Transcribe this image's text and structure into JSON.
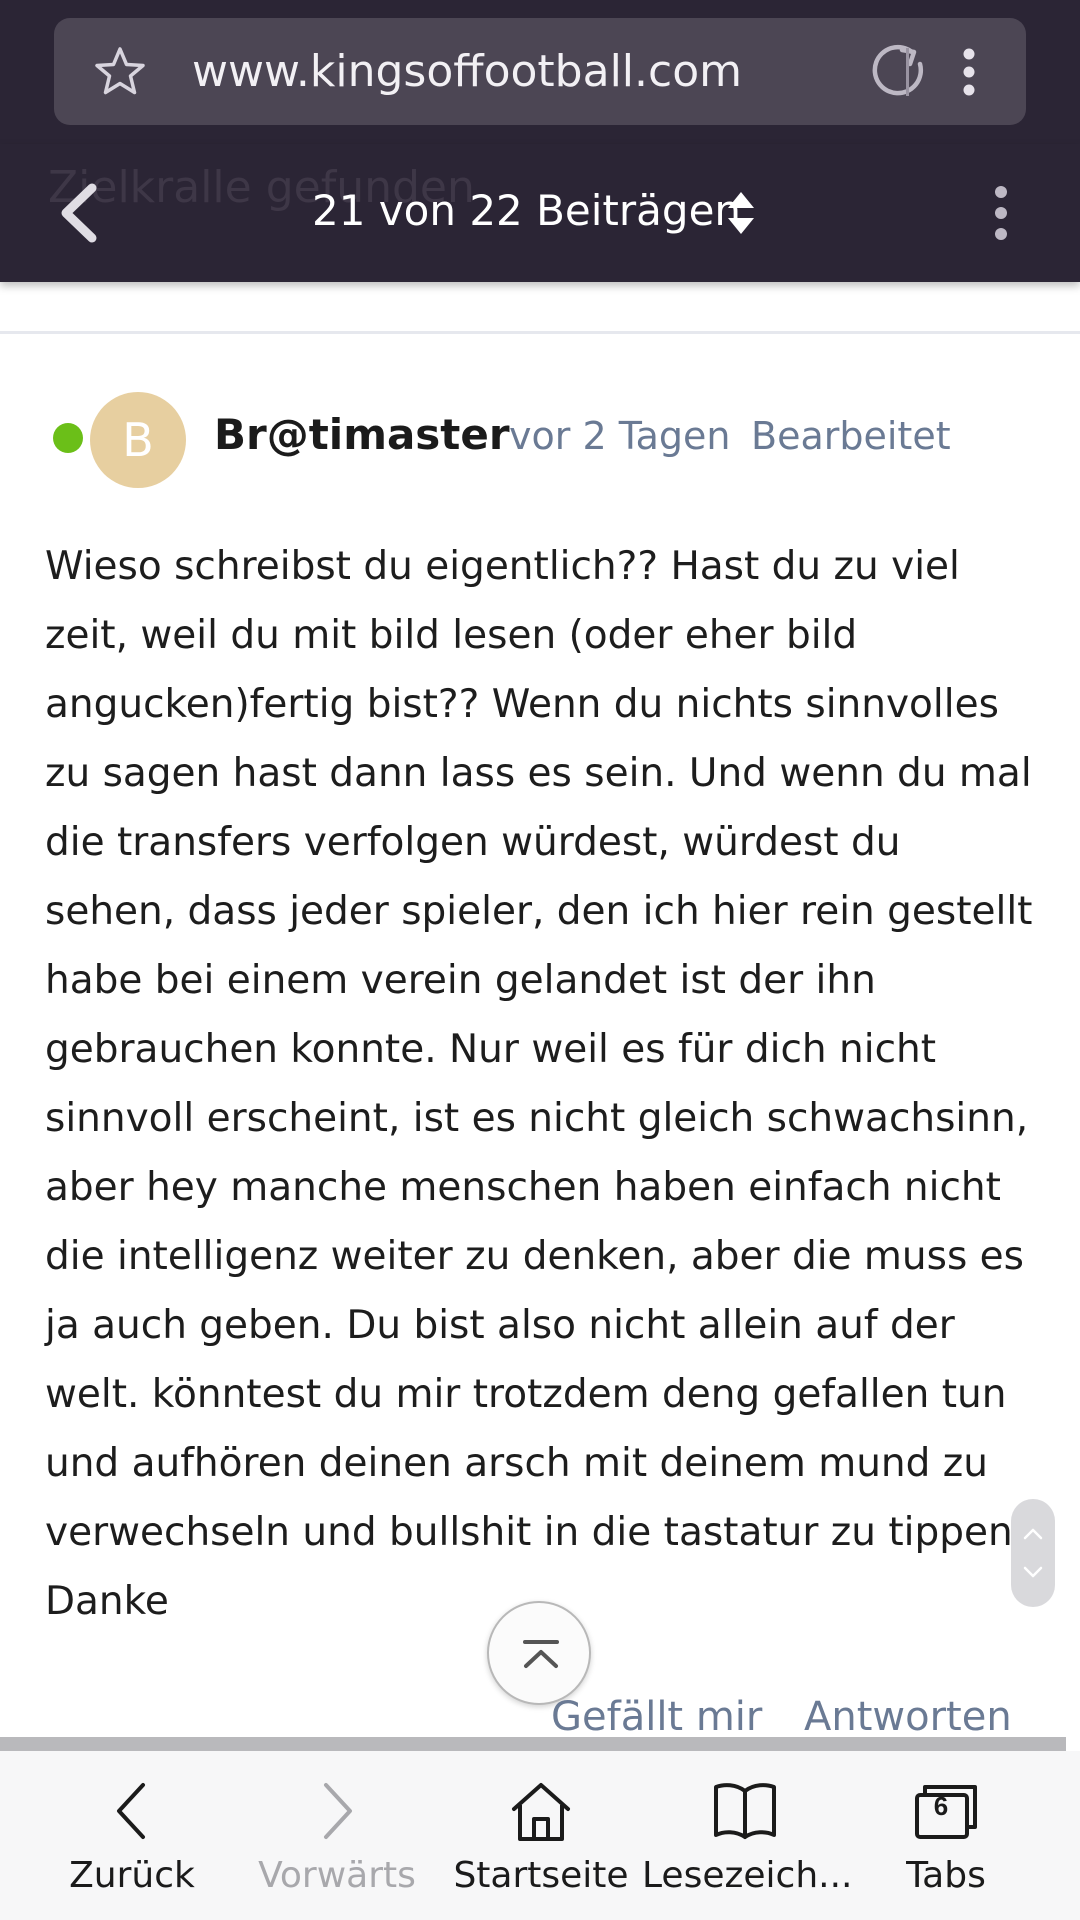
{
  "browser": {
    "url": "www.kingsoffootball.com"
  },
  "thread": {
    "ghost_title": "Zielkralle gefunden",
    "post_counter": "21 von 22 Beiträgen"
  },
  "post": {
    "author_initial": "B",
    "author": "Br@timaster",
    "timestamp": "vor 2 Tagen",
    "edited_label": "Bearbeitet",
    "body_lines": [
      "Wieso schreibst du eigentlich?? Hast du zu viel",
      "zeit, weil du mit bild lesen (oder eher bild",
      "angucken)fertig bist?? Wenn du nichts sinnvolles",
      "zu sagen hast dann lass es sein. Und wenn du mal",
      "die transfers verfolgen würdest, würdest du",
      "sehen, dass jeder spieler, den ich hier rein gestellt",
      "habe bei einem verein gelandet ist der ihn",
      "gebrauchen konnte. Nur weil es für dich nicht",
      "sinnvoll erscheint, ist es nicht gleich schwachsinn,",
      "aber hey manche menschen haben einfach nicht",
      "die intelligenz weiter zu denken, aber die muss es",
      "ja auch geben. Du bist also nicht allein auf der",
      "welt. könntest du mir trotzdem deng gefallen tun",
      "und aufhören deinen arsch mit deinem mund zu",
      "verwechseln und bullshit in die tastatur zu tippen.",
      "Danke"
    ],
    "like_label": "Gefällt mir",
    "reply_label": "Antworten"
  },
  "bottom_nav": {
    "back": "Zurück",
    "forward": "Vorwärts",
    "home": "Startseite",
    "bookmarks": "Lesezeich...",
    "tabs": "Tabs",
    "tabs_count": "6"
  },
  "colors": {
    "chrome_bg": "#2b2535",
    "url_bar_bg": "#4c4654",
    "meta_text": "#6a7a94",
    "online": "#6bbf18",
    "avatar_bg": "#e7cfa0"
  },
  "icons": [
    "star-icon",
    "reload-icon",
    "more-vertical-icon",
    "back-chevron-icon",
    "sort-updown-icon",
    "scroll-up-icon",
    "scroll-down-icon",
    "to-top-icon",
    "nav-back-icon",
    "nav-forward-icon",
    "home-icon",
    "bookmarks-book-icon",
    "tabs-icon"
  ]
}
